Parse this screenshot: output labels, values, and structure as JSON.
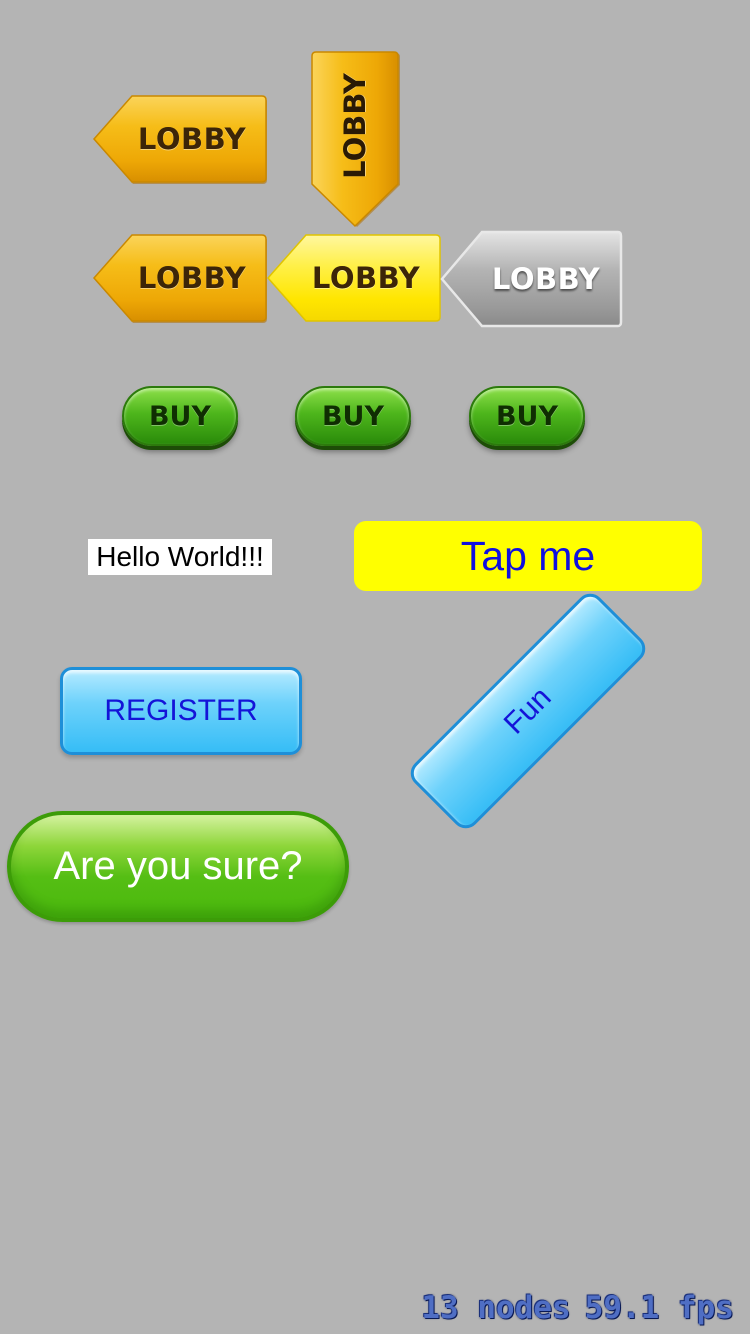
{
  "lobby_buttons": [
    {
      "label": "LOBBY",
      "style": "orange",
      "direction": "left"
    },
    {
      "label": "LOBBY",
      "style": "orange",
      "direction": "down"
    },
    {
      "label": "LOBBY",
      "style": "orange",
      "direction": "left"
    },
    {
      "label": "LOBBY",
      "style": "yellow",
      "direction": "left"
    },
    {
      "label": "LOBBY",
      "style": "gray",
      "direction": "left"
    }
  ],
  "buy_buttons": [
    {
      "label": "BUY"
    },
    {
      "label": "BUY"
    },
    {
      "label": "BUY"
    }
  ],
  "hello_label": "Hello World!!!",
  "tap_button": {
    "label": "Tap me",
    "background": "#ffff00",
    "text_color": "#1010e0"
  },
  "register_button": {
    "label": "REGISTER"
  },
  "fun_button": {
    "label": "Fun"
  },
  "confirm_button": {
    "label": "Are you sure?"
  },
  "stats": {
    "nodes": "13 nodes",
    "fps": "59.1 fps"
  },
  "colors": {
    "background": "#b4b4b4",
    "orange": "#f2b10c",
    "yellow": "#ffea00",
    "gray": "#9a9a9a",
    "green": "#4eb61c",
    "blue": "#36bdf6"
  }
}
